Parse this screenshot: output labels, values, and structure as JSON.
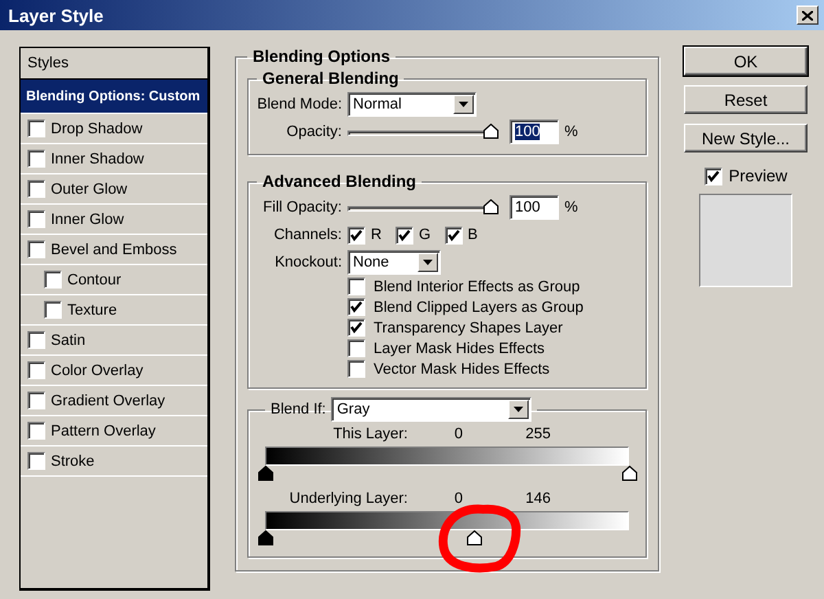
{
  "window": {
    "title": "Layer Style"
  },
  "styles_panel": {
    "items": [
      {
        "label": "Styles",
        "kind": "header",
        "selected": false
      },
      {
        "label": "Blending Options: Custom",
        "kind": "header",
        "selected": true
      },
      {
        "label": "Drop Shadow",
        "kind": "effect",
        "checked": false,
        "selected": false
      },
      {
        "label": "Inner Shadow",
        "kind": "effect",
        "checked": false,
        "selected": false
      },
      {
        "label": "Outer Glow",
        "kind": "effect",
        "checked": false,
        "selected": false
      },
      {
        "label": "Inner Glow",
        "kind": "effect",
        "checked": false,
        "selected": false
      },
      {
        "label": "Bevel and Emboss",
        "kind": "effect",
        "checked": false,
        "selected": false,
        "children": [
          {
            "label": "Contour",
            "kind": "effect",
            "checked": false,
            "selected": false
          },
          {
            "label": "Texture",
            "kind": "effect",
            "checked": false,
            "selected": false
          }
        ]
      },
      {
        "label": "Satin",
        "kind": "effect",
        "checked": false,
        "selected": false
      },
      {
        "label": "Color Overlay",
        "kind": "effect",
        "checked": false,
        "selected": false
      },
      {
        "label": "Gradient Overlay",
        "kind": "effect",
        "checked": false,
        "selected": false
      },
      {
        "label": "Pattern Overlay",
        "kind": "effect",
        "checked": false,
        "selected": false
      },
      {
        "label": "Stroke",
        "kind": "effect",
        "checked": false,
        "selected": false
      }
    ]
  },
  "blending_options": {
    "title": "Blending Options",
    "general_blending": {
      "title": "General Blending",
      "blend_mode": {
        "label": "Blend Mode:",
        "value": "Normal"
      },
      "opacity": {
        "label": "Opacity:",
        "level": 1,
        "value": "100",
        "selected": true,
        "unit": "%"
      }
    },
    "advanced_blending": {
      "title": "Advanced Blending",
      "fill_opacity": {
        "label": "Fill Opacity:",
        "level": 1,
        "value": "100",
        "selected": false,
        "unit": "%"
      },
      "channels": {
        "label": "Channels:",
        "items": [
          {
            "label": "R",
            "checked": true
          },
          {
            "label": "G",
            "checked": true
          },
          {
            "label": "B",
            "checked": true
          }
        ]
      },
      "knockout": {
        "label": "Knockout:",
        "value": "None"
      },
      "options": [
        {
          "label": "Blend Interior Effects as Group",
          "checked": false
        },
        {
          "label": "Blend Clipped Layers as Group",
          "checked": true
        },
        {
          "label": "Transparency Shapes Layer",
          "checked": true
        },
        {
          "label": "Layer Mask Hides Effects",
          "checked": false
        },
        {
          "label": "Vector Mask Hides Effects",
          "checked": false
        }
      ]
    },
    "blend_if": {
      "label": "Blend If:",
      "value": "Gray",
      "sliders": [
        {
          "label": "This Layer:",
          "low": "0",
          "high": "255",
          "thumbs": [
            {
              "level": 0
            },
            {
              "level": 1
            }
          ]
        },
        {
          "label": "Underlying Layer:",
          "low": "0",
          "high": "146",
          "thumbs": [
            {
              "level": 0
            },
            {
              "level": 0.573
            }
          ]
        }
      ]
    }
  },
  "buttons": [
    {
      "label": "OK",
      "default": true
    },
    {
      "label": "Reset",
      "default": false
    },
    {
      "label": "New Style...",
      "default": false
    }
  ],
  "preview": {
    "label": "Preview",
    "checked": true
  }
}
